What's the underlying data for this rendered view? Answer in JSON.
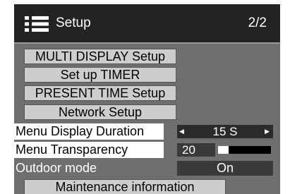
{
  "header": {
    "icon": "menu-list-icon",
    "title": "Setup",
    "page": "2/2"
  },
  "menu": {
    "buttons": [
      "MULTI DISPLAY Setup",
      "Set up TIMER",
      "PRESENT TIME Setup",
      "Network Setup"
    ],
    "menu_display_duration": {
      "label": "Menu Display Duration",
      "value": "15 S"
    },
    "menu_transparency": {
      "label": "Menu Transparency",
      "value": "20",
      "level_fraction": 0.2
    },
    "outdoor_mode": {
      "label": "Outdoor mode",
      "value": "On"
    },
    "maintenance": "Maintenance information"
  },
  "colors": {
    "panel_bg": "#6f6f6f",
    "header_bg": "#232323",
    "button_bg": "#cdcdcd",
    "value_bg": "#3a3a3a"
  }
}
